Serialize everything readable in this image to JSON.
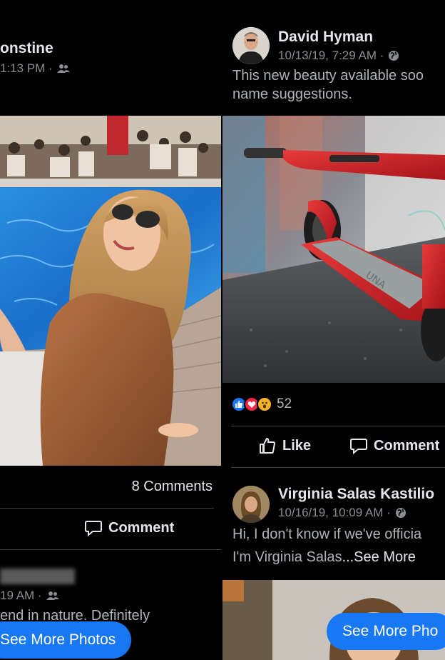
{
  "left_post": {
    "author_partial": "onstine",
    "time_partial": "1:13 PM ·",
    "audience_icon": "friends-icon",
    "comments_count": "8 Comments",
    "comment_label": "Comment",
    "next_time_partial": "19 AM ·",
    "next_text_partial": "end in nature. Definitely",
    "see_more_photos": "See More Photos"
  },
  "right_post": {
    "author": "David Hyman",
    "time": "10/13/19, 7:29 AM ·",
    "audience_icon": "globe-icon",
    "text_line1": "This new beauty available soo",
    "text_line2": "name suggestions.",
    "reaction_count": "52",
    "like_label": "Like",
    "comment_label": "Comment"
  },
  "right_post_2": {
    "author": "Virginia Salas Kastilio",
    "time": "10/16/19, 10:09 AM ·",
    "audience_icon": "globe-icon",
    "text_line1": "Hi, I don't know if we've officia",
    "text_line2": "I'm Virginia Salas",
    "see_more": "...See More",
    "see_more_photos": "See More Pho"
  },
  "colors": {
    "background": "#000000",
    "accent": "#1877f2",
    "text_primary": "#e4e6eb",
    "text_secondary": "#8a8d91"
  }
}
